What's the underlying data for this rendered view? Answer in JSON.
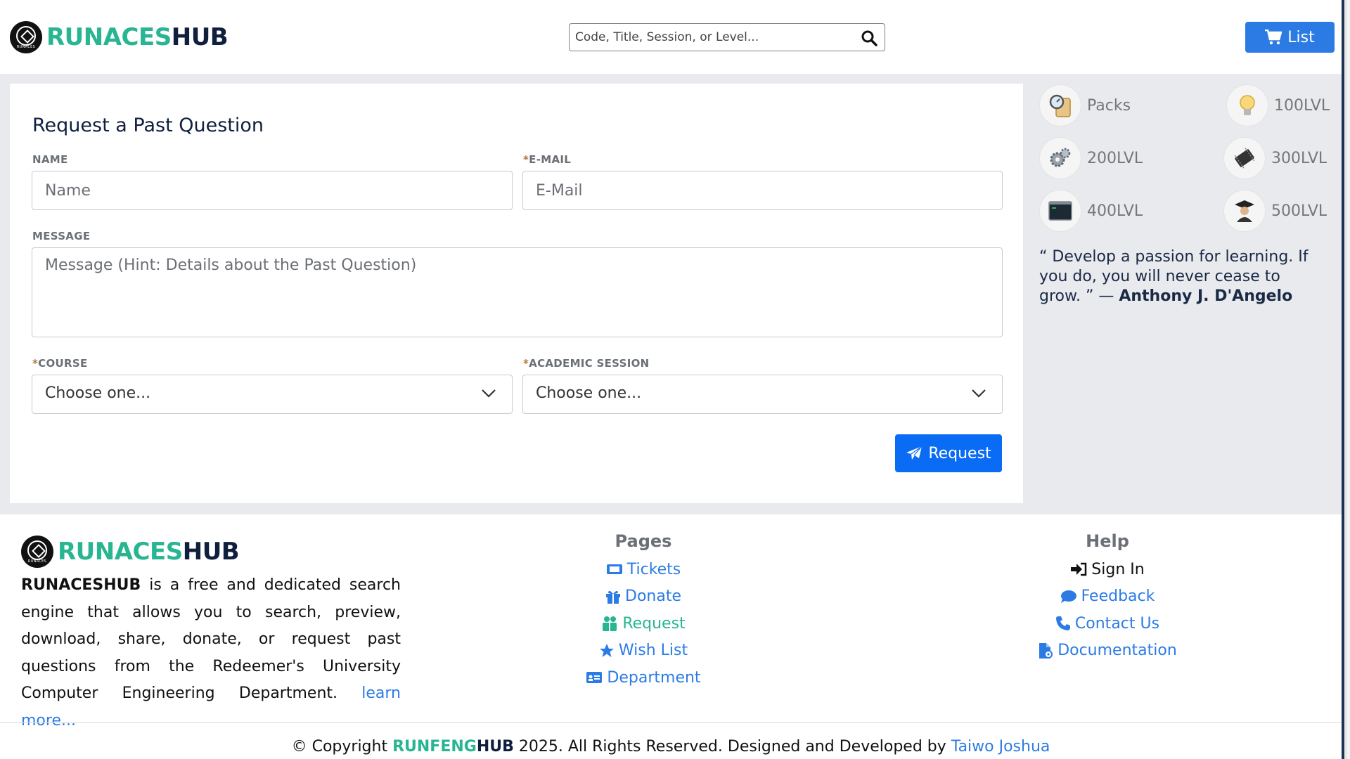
{
  "header": {
    "logo_part1": "RUNACES",
    "logo_part2": "HUB",
    "logo_badge": "RUNACES",
    "search_placeholder": "Code, Title, Session, or Level...",
    "list_label": "List"
  },
  "form": {
    "title": "Request a Past Question",
    "name_label": "NAME",
    "name_placeholder": "Name",
    "email_required": "*",
    "email_label": "E-MAIL",
    "email_placeholder": "E-Mail",
    "message_label": "MESSAGE",
    "message_placeholder": "Message (Hint: Details about the Past Question)",
    "course_required": "*",
    "course_label": "COURSE",
    "course_value": "Choose one...",
    "session_required": "*",
    "session_label": "ACADEMIC SESSION",
    "session_value": "Choose one...",
    "submit_label": "Request"
  },
  "sidebar": {
    "levels": [
      {
        "label": "Packs",
        "icon": "magnifier-scroll-icon"
      },
      {
        "label": "100LVL",
        "icon": "lightbulb-icon"
      },
      {
        "label": "200LVL",
        "icon": "gears-icon"
      },
      {
        "label": "300LVL",
        "icon": "microchip-icon"
      },
      {
        "label": "400LVL",
        "icon": "terminal-icon"
      },
      {
        "label": "500LVL",
        "icon": "graduate-icon"
      }
    ],
    "quote_text": "“ Develop a passion for learning. If you do, you will never cease to grow. ” — ",
    "quote_author": "Anthony J. D'Angelo"
  },
  "footer": {
    "brand": "RUNACESHUB",
    "description": " is a free and dedicated search engine that allows you to search, preview, download, share, donate, or request past questions from the Redeemer's University Computer Engineering Department. ",
    "learn_more": "learn more...",
    "pages_title": "Pages",
    "pages": [
      {
        "label": "Tickets",
        "icon": "ticket-icon"
      },
      {
        "label": "Donate",
        "icon": "gift-icon"
      },
      {
        "label": "Request",
        "icon": "request-people-icon"
      },
      {
        "label": "Wish List",
        "icon": "star-icon"
      },
      {
        "label": "Department",
        "icon": "id-card-icon"
      }
    ],
    "help_title": "Help",
    "help": [
      {
        "label": "Sign In",
        "icon": "sign-in-icon"
      },
      {
        "label": "Feedback",
        "icon": "comment-icon"
      },
      {
        "label": "Contact Us",
        "icon": "phone-icon"
      },
      {
        "label": "Documentation",
        "icon": "file-icon"
      }
    ],
    "copyright_prefix": "© Copyright ",
    "copyright_brand1": "RUNFENG",
    "copyright_brand2": "HUB",
    "copyright_middle": " 2025. All Rights Reserved. Designed and Developed by ",
    "copyright_author": "Taiwo Joshua"
  },
  "colors": {
    "brand_green": "#27b592",
    "brand_navy": "#0f1f3d",
    "primary_blue": "#2c7be5",
    "button_blue": "#0a6cf5"
  }
}
